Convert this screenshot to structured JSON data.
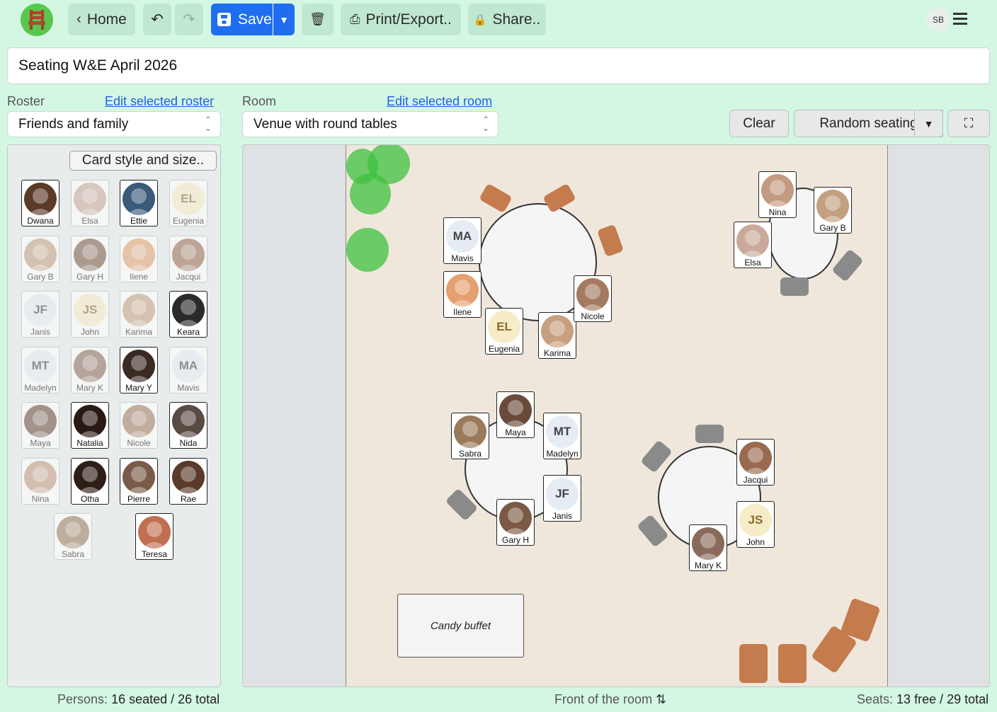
{
  "toolbar": {
    "home": "Home",
    "save": "Save",
    "print": "Print/Export..",
    "share": "Share..",
    "user_initials": "SB"
  },
  "title": "Seating W&E April 2026",
  "roster": {
    "label": "Roster",
    "edit_link": "Edit selected roster",
    "selected": "Friends and family",
    "card_button": "Card style and size.."
  },
  "room": {
    "label": "Room",
    "edit_link": "Edit selected room",
    "selected": "Venue with round tables",
    "clear": "Clear",
    "random": "Random seating"
  },
  "persons": [
    {
      "name": "Dwana",
      "seated": false,
      "initials": "",
      "color": "#5b3a2a"
    },
    {
      "name": "Elsa",
      "seated": true,
      "initials": "",
      "color": "#c9a99a"
    },
    {
      "name": "Ettie",
      "seated": false,
      "initials": "",
      "color": "#3a5a7a"
    },
    {
      "name": "Eugenia",
      "seated": true,
      "initials": "EL",
      "color": "#f6ecc7"
    },
    {
      "name": "Gary B",
      "seated": true,
      "initials": "",
      "color": "#c2a080"
    },
    {
      "name": "Gary H",
      "seated": true,
      "initials": "",
      "color": "#7a5a44"
    },
    {
      "name": "Ilene",
      "seated": true,
      "initials": "",
      "color": "#e5a070"
    },
    {
      "name": "Jacqui",
      "seated": true,
      "initials": "",
      "color": "#9a6a50"
    },
    {
      "name": "Janis",
      "seated": true,
      "initials": "JF",
      "color": "#e6ecf4"
    },
    {
      "name": "John",
      "seated": true,
      "initials": "JS",
      "color": "#f6ecc7"
    },
    {
      "name": "Karima",
      "seated": true,
      "initials": "",
      "color": "#c8a080"
    },
    {
      "name": "Keara",
      "seated": false,
      "initials": "",
      "color": "#2a2a2a"
    },
    {
      "name": "Madelyn",
      "seated": true,
      "initials": "MT",
      "color": "#e6ecf4"
    },
    {
      "name": "Mary K",
      "seated": true,
      "initials": "",
      "color": "#8a6a5a"
    },
    {
      "name": "Mary Y",
      "seated": false,
      "initials": "",
      "color": "#3a2a24"
    },
    {
      "name": "Mavis",
      "seated": true,
      "initials": "MA",
      "color": "#e6ecf4"
    },
    {
      "name": "Maya",
      "seated": true,
      "initials": "",
      "color": "#6a4a3a"
    },
    {
      "name": "Natalia",
      "seated": false,
      "initials": "",
      "color": "#2a1a14"
    },
    {
      "name": "Nicole",
      "seated": true,
      "initials": "",
      "color": "#a47a60"
    },
    {
      "name": "Nida",
      "seated": false,
      "initials": "",
      "color": "#5a4a44"
    },
    {
      "name": "Nina",
      "seated": true,
      "initials": "",
      "color": "#c49a80"
    },
    {
      "name": "Otha",
      "seated": false,
      "initials": "",
      "color": "#2e1e18"
    },
    {
      "name": "Pierre",
      "seated": false,
      "initials": "",
      "color": "#7a5a48"
    },
    {
      "name": "Rae",
      "seated": false,
      "initials": "",
      "color": "#5a3a2a"
    },
    {
      "name": "Sabra",
      "seated": true,
      "initials": "",
      "color": "#9a7a5a"
    },
    {
      "name": "Teresa",
      "seated": false,
      "initials": "",
      "color": "#c07050"
    }
  ],
  "room_items": {
    "buffet": "Candy buffet"
  },
  "footer": {
    "persons_label": "Persons:",
    "persons_value": "16 seated / 26 total",
    "front": "Front of the room",
    "seats_label": "Seats:",
    "seats_value": "13 free / 29 total"
  }
}
